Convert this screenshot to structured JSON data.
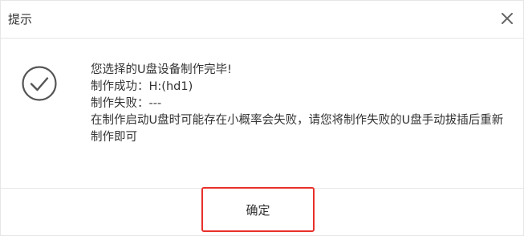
{
  "dialog": {
    "title": "提示",
    "close_icon": "close-icon",
    "status_icon": "check-circle-icon",
    "message_lines": [
      "您选择的U盘设备制作完毕!",
      "制作成功：H:(hd1)",
      "制作失败：---",
      "在制作启动U盘时可能存在小概率会失败，请您将制作失败的U盘手动拔插后重新制作即可"
    ],
    "ok_label": "确定",
    "colors": {
      "highlight_border": "#e8302a",
      "divider": "#e5e5e5",
      "text": "#333333",
      "icon": "#555555"
    }
  }
}
